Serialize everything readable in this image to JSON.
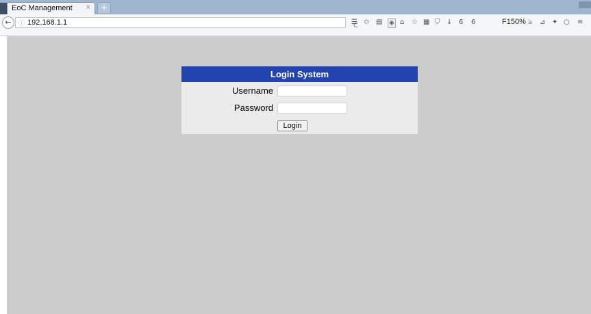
{
  "browser": {
    "tab_title": "EoC Management",
    "tab_close": "×",
    "new_tab": "+",
    "address": "192.168.1.1",
    "back_icon": "←",
    "info_icon": "ⓘ",
    "reload_icon": "C",
    "zoom": "F150%",
    "toolbar_icons": [
      {
        "name": "reading-list-icon",
        "glyph": "☰"
      },
      {
        "name": "bookmark-star-icon",
        "glyph": "✩"
      },
      {
        "name": "reader-view-icon",
        "glyph": "▤"
      },
      {
        "name": "extension-icon",
        "glyph": "◈"
      },
      {
        "name": "home-icon",
        "glyph": "⌂"
      },
      {
        "name": "star-icon",
        "glyph": "☆"
      },
      {
        "name": "bookmarks-icon",
        "glyph": "▦"
      },
      {
        "name": "pocket-icon",
        "glyph": "⛉"
      },
      {
        "name": "download-icon",
        "glyph": "↓"
      },
      {
        "name": "addon-6-icon",
        "glyph": "6"
      },
      {
        "name": "addon-6b-icon",
        "glyph": "6"
      },
      {
        "name": "rss-icon",
        "glyph": "৯"
      },
      {
        "name": "send-icon",
        "glyph": "⊿"
      },
      {
        "name": "sync-icon",
        "glyph": "✦"
      },
      {
        "name": "search-circle-icon",
        "glyph": "○"
      },
      {
        "name": "menu-icon",
        "glyph": "≡"
      }
    ]
  },
  "login": {
    "title": "Login System",
    "username_label": "Username",
    "username_value": "",
    "password_label": "Password",
    "password_value": "",
    "submit_label": "Login"
  },
  "colors": {
    "header_bg": "#2244b0",
    "page_bg": "#cccccc",
    "panel_bg": "#ebebeb"
  }
}
